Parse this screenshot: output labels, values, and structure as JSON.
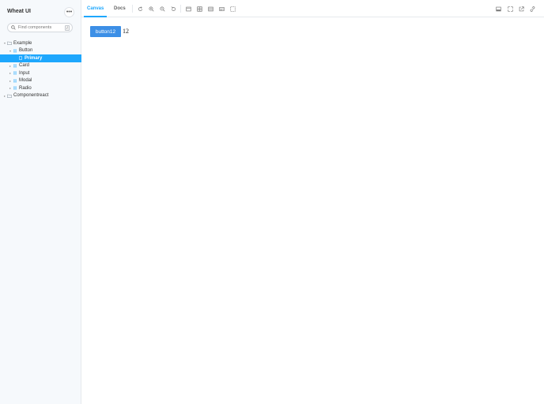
{
  "sidebar": {
    "brand": "Wheat UI",
    "search_placeholder": "Find components",
    "search_key": "/",
    "tree": [
      {
        "label": "Example",
        "type": "folder",
        "expanded": true
      },
      {
        "label": "Button",
        "type": "component",
        "expanded": true
      },
      {
        "label": "Primary",
        "type": "story",
        "selected": true
      },
      {
        "label": "Card",
        "type": "component"
      },
      {
        "label": "Input",
        "type": "component"
      },
      {
        "label": "Modal",
        "type": "component"
      },
      {
        "label": "Radio",
        "type": "component"
      },
      {
        "label": "Componentreact",
        "type": "folder"
      }
    ]
  },
  "toolbar": {
    "tabs": [
      {
        "label": "Canvas",
        "active": true
      },
      {
        "label": "Docs",
        "active": false
      }
    ],
    "left_icons": [
      "reload-icon",
      "zoom-in-icon",
      "zoom-out-icon",
      "zoom-reset-icon",
      "background-icon",
      "grid-icon",
      "viewport-icon",
      "measure-icon",
      "outline-icon"
    ],
    "right_icons": [
      "addons-panel-icon",
      "fullscreen-icon",
      "open-new-tab-icon",
      "copy-link-icon"
    ]
  },
  "canvas": {
    "button_label": "button12",
    "count": "12"
  },
  "colors": {
    "accent": "#1ea7fd",
    "button": "#3c8fe6",
    "sidebar_bg": "#f6f9fc"
  }
}
